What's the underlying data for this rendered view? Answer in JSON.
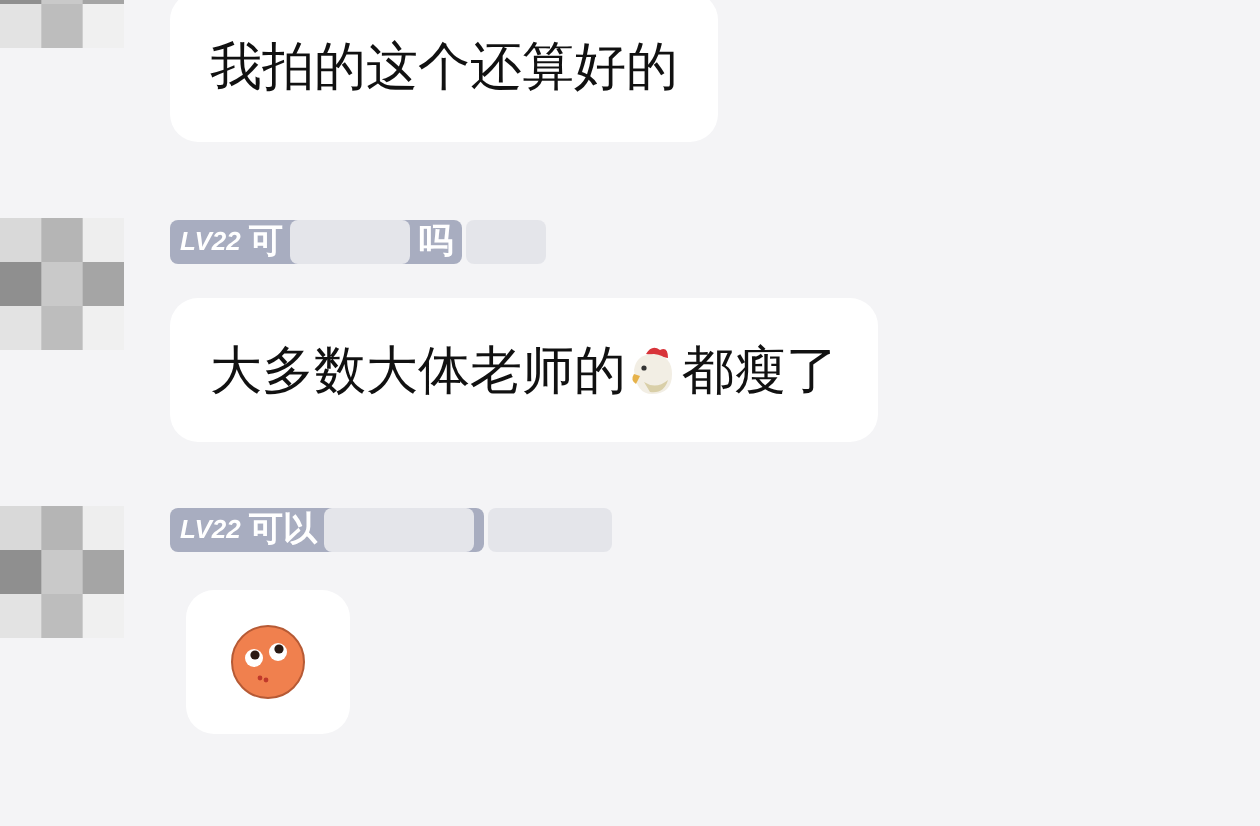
{
  "messages": [
    {
      "kind": "text",
      "text": "我拍的这个还算好的"
    },
    {
      "kind": "text_with_emoji",
      "level": "LV22",
      "name_start": "可",
      "name_end": "吗",
      "text_before": "大多数大体老师的",
      "text_after": "都瘦了"
    },
    {
      "kind": "sticker",
      "level": "LV22",
      "name_start": "可以"
    }
  ]
}
